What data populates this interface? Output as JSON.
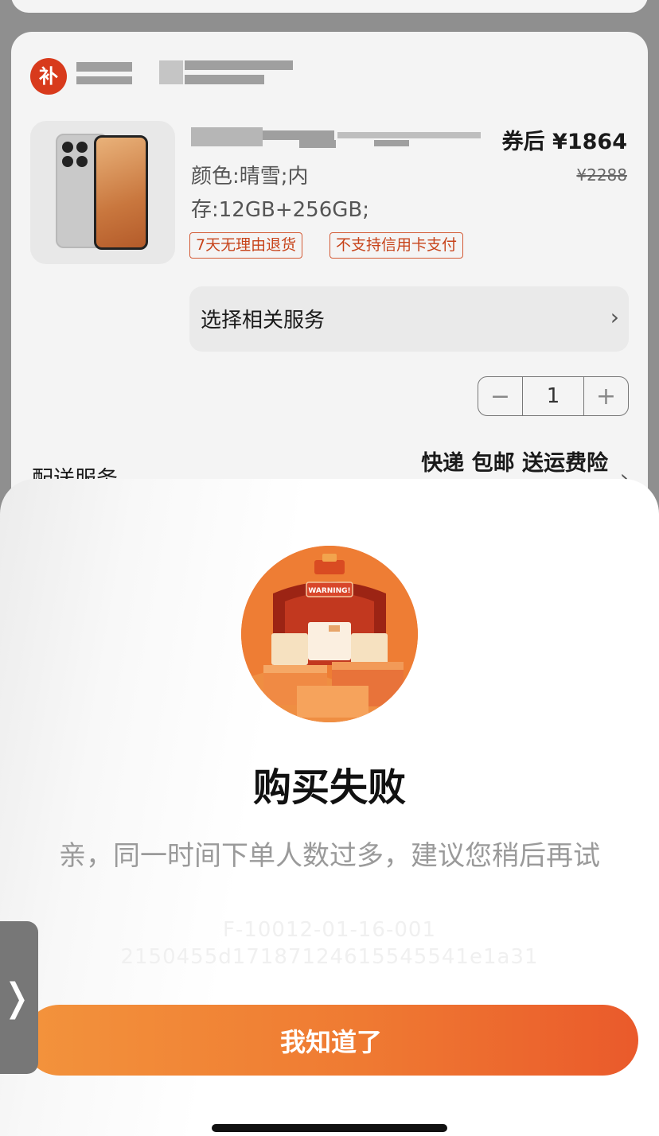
{
  "shop": {
    "logo_char": "补"
  },
  "product": {
    "price_label": "券后 ¥1864",
    "original_price": "¥2288",
    "spec_line1": "颜色:晴雪;内",
    "spec_line2": "存:12GB+256GB;",
    "tags": [
      "7天无理由退货",
      "不支持信用卡支付"
    ],
    "service_label": "选择相关服务",
    "quantity": "1",
    "minus": "−",
    "plus": "+"
  },
  "delivery": {
    "label": "配送服务",
    "value": "快递 包邮 送运费险"
  },
  "modal": {
    "illustration_text": "WARNING!",
    "title": "购买失败",
    "message": "亲，同一时间下单人数过多，建议您稍后再试",
    "error_code": "F-10012-01-16-001",
    "trace_id": "2150455d17187124615545541e1a31",
    "confirm_label": "我知道了"
  },
  "side_tab": {
    "glyph": "❭"
  },
  "colors": {
    "accent_orange": "#ef7a32",
    "tag_red": "#c7431a",
    "shop_logo_red": "#d83a1c"
  }
}
